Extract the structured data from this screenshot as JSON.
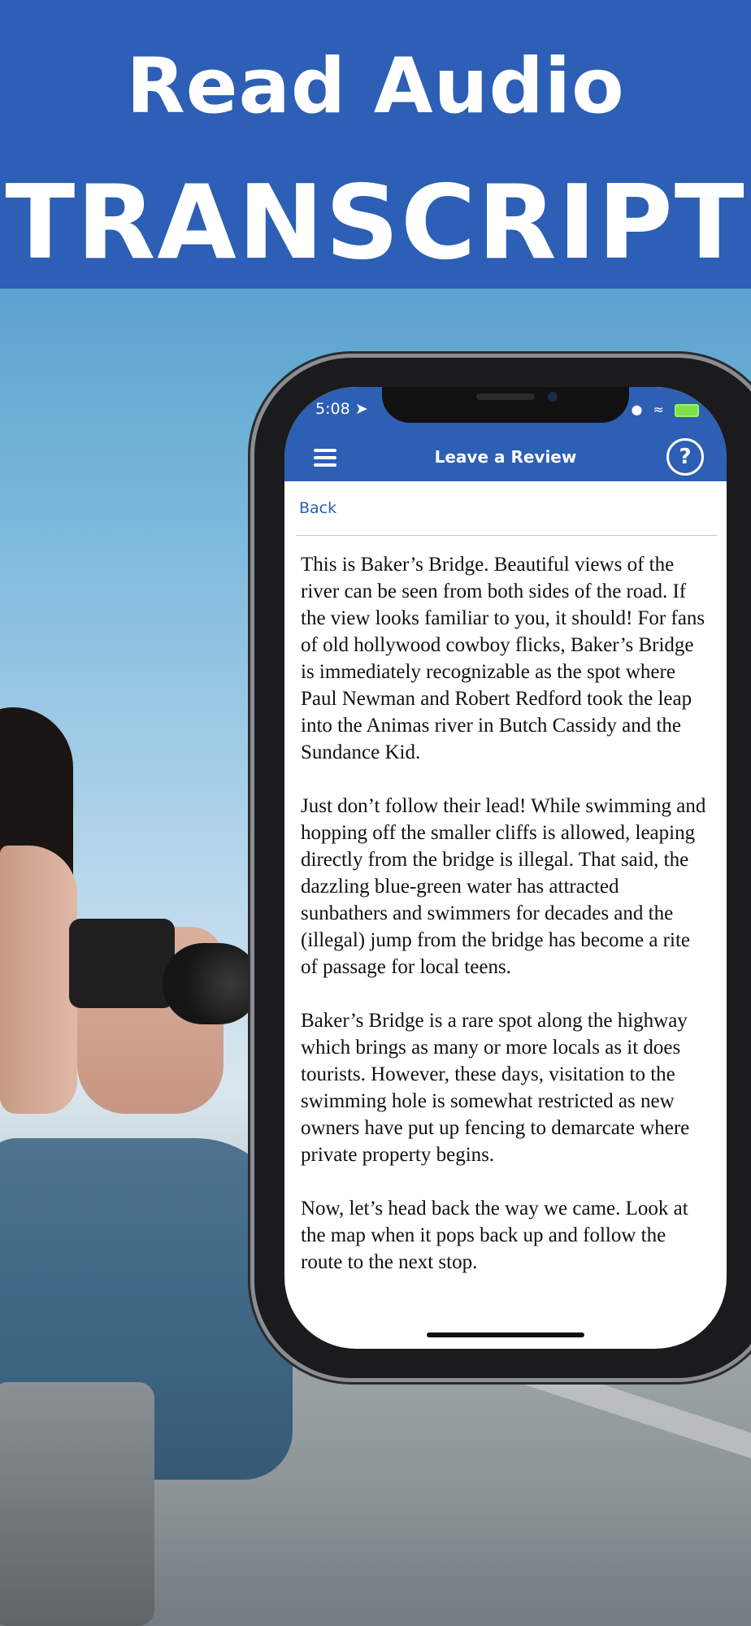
{
  "banner": {
    "line1": "Read Audio",
    "line2": "TRANSCRIPT"
  },
  "status_bar": {
    "time": "5:08 ➤"
  },
  "nav": {
    "title": "Leave a Review",
    "help": "?"
  },
  "back_link": "Back",
  "transcript": [
    "This is Baker’s Bridge. Beautiful views of the river can be seen from both sides of the road. If the view looks familiar to you, it should! For fans of old hollywood cowboy flicks, Baker’s Bridge is immediately recognizable as the spot where Paul Newman and Robert Redford took the leap into the Animas river in Butch Cassidy and the Sundance Kid.",
    "Just don’t follow their lead! While swimming and hopping off the smaller cliffs is allowed, leaping directly from the bridge is illegal. That said, the dazzling blue-green water has attracted sunbathers and swimmers for decades and the (illegal) jump from the bridge has become a rite of passage for local teens.",
    "Baker’s Bridge is a rare spot along the highway which brings as many or more locals as it does tourists. However, these days, visitation to the swimming hole is somewhat restricted as new owners have put up fencing to demarcate where private property begins.",
    "Now, let’s head back the way we came. Look at the map when it pops back up and follow the route to the next stop."
  ],
  "colors": {
    "brand_blue": "#2c5fb5",
    "link_blue": "#2d5fb4"
  }
}
